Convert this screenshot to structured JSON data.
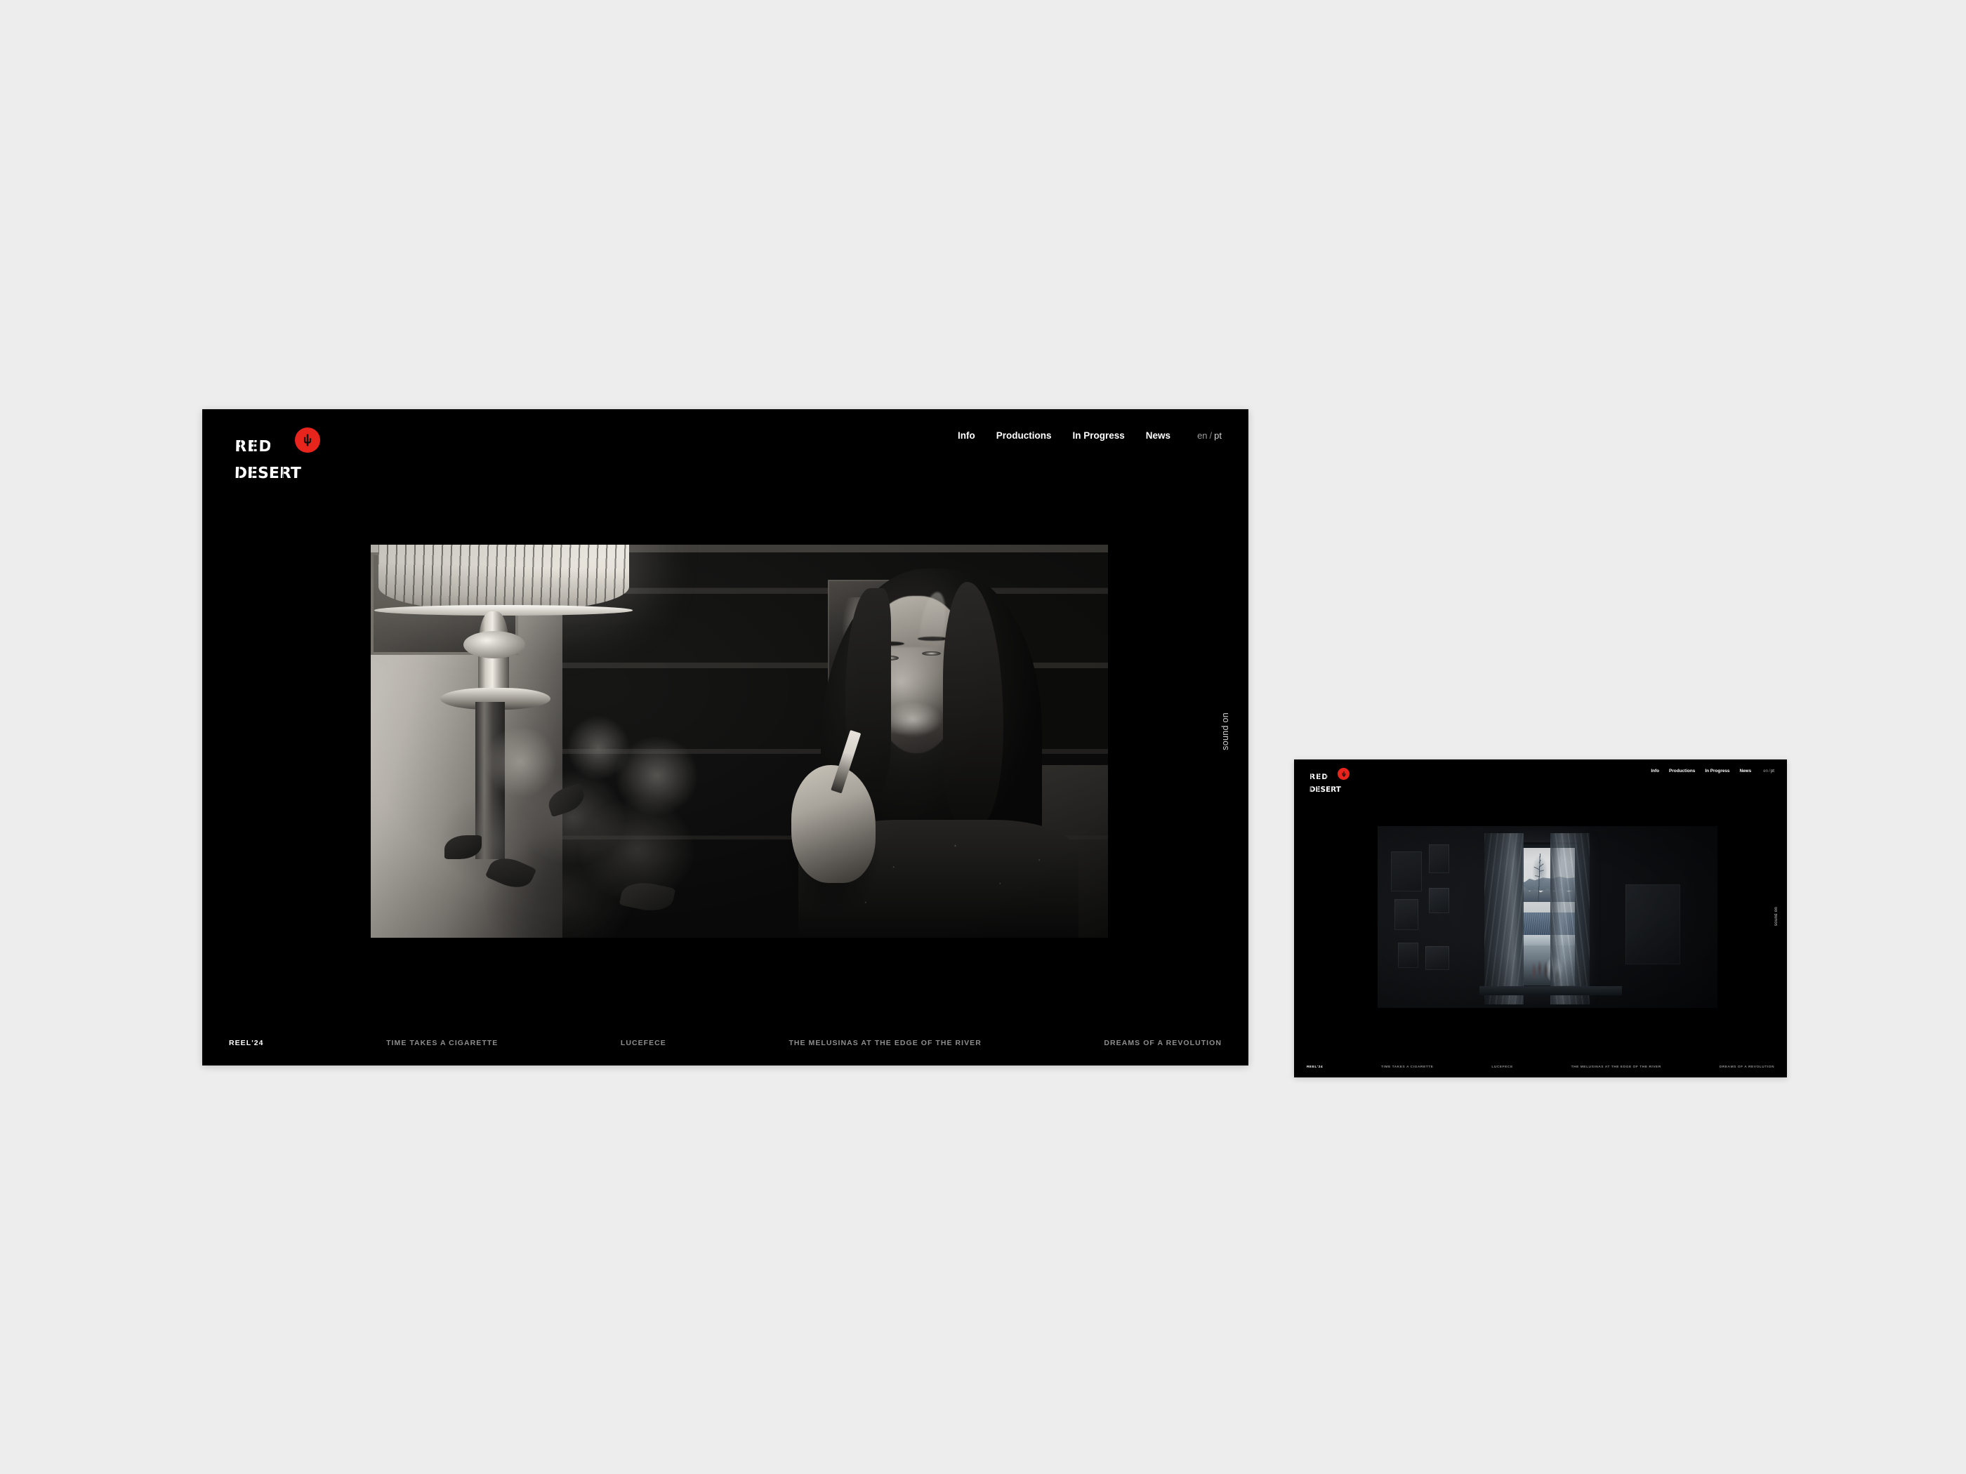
{
  "page": {
    "background_color": "#ededed",
    "window_background": "#000000",
    "accent_color": "#e8251c"
  },
  "site": {
    "logo": {
      "line1": "RED",
      "line2": "DESERT",
      "badge_icon": "cactus-icon",
      "badge_color": "#e8251c"
    },
    "nav": [
      {
        "label": "Info",
        "name": "nav-info"
      },
      {
        "label": "Productions",
        "name": "nav-productions"
      },
      {
        "label": "In Progress",
        "name": "nav-in-progress"
      },
      {
        "label": "News",
        "name": "nav-news"
      }
    ],
    "language": {
      "en": "en",
      "separator": "/",
      "pt": "pt",
      "active": "pt"
    },
    "sound_toggle": "sound on",
    "projects": [
      {
        "label": "REEL'24",
        "active": true
      },
      {
        "label": "TIME TAKES A CIGARETTE",
        "active": false
      },
      {
        "label": "LUCEFECE",
        "active": false
      },
      {
        "label": "THE MELUSINAS AT THE EDGE OF THE RIVER",
        "active": false
      },
      {
        "label": "DREAMS OF A REVOLUTION",
        "active": false
      }
    ]
  },
  "windows": {
    "primary": {
      "hero_description": "Black and white film still: a young woman with long dark hair holding a lit cigarette, seated beside a lit table lamp, flowers and a bookshelf behind her."
    },
    "secondary": {
      "hero_description": "Dark interior room with a tall window and sheer curtains looking out over a pale winter landscape with bare trees, houses and water."
    }
  }
}
